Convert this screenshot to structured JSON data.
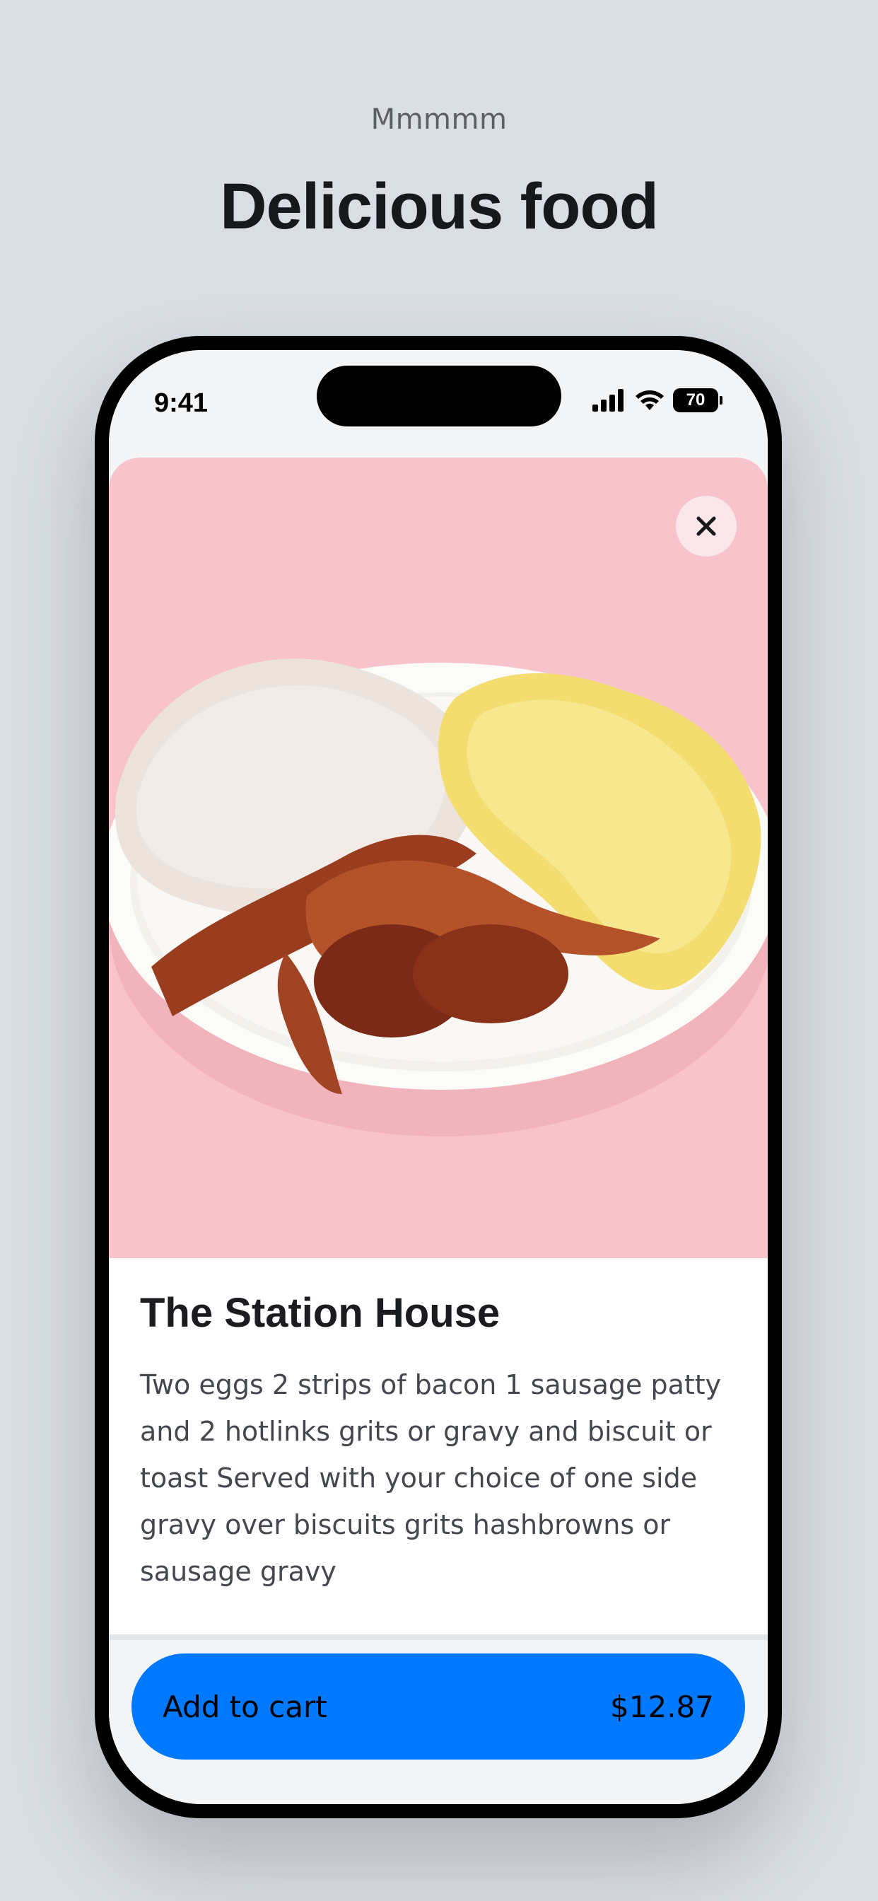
{
  "header": {
    "eyebrow": "Mmmmm",
    "headline": "Delicious food"
  },
  "status_bar": {
    "time": "9:41",
    "battery_level": "70",
    "icons": [
      "cellular-signal-icon",
      "wifi-icon",
      "battery-icon"
    ]
  },
  "product": {
    "image_icon": "breakfast-plate-image",
    "title": "The Station House",
    "description": "Two eggs 2 strips of bacon 1 sausage patty and 2 hotlinks grits or gravy and biscuit or toast Served with your choice of one side gravy over biscuits grits hashbrowns or sausage gravy"
  },
  "actions": {
    "close_icon": "close-icon",
    "add_to_cart_label": "Add to cart",
    "price": "$12.87"
  },
  "colors": {
    "page_background": "#d9dde4",
    "image_background": "#f9c3cb",
    "accent": "#0079ff"
  }
}
